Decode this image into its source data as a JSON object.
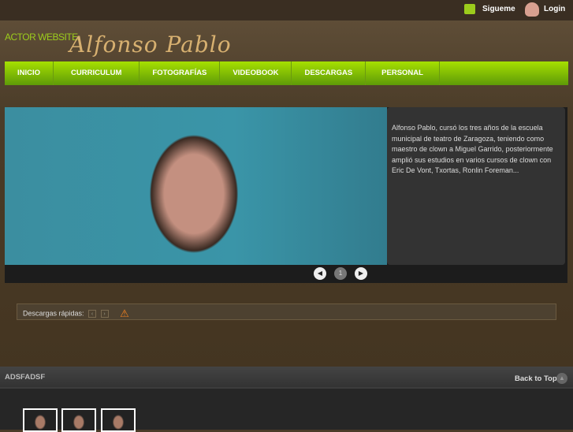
{
  "topbar": {
    "follow": "Sigueme",
    "login": "Login"
  },
  "header": {
    "tagline": "ACTOR WEBSITE",
    "name": "Alfonso Pablo"
  },
  "nav": [
    "INICIO",
    "CURRICULUM",
    "FOTOGRAFÍAS",
    "VIDEOBOOK",
    "DESCARGAS",
    "PERSONAL"
  ],
  "slider": {
    "description": "Alfonso Pablo, cursó los tres años de la escuela municipal de teatro de Zaragoza, teniendo como maestro de clown a Miguel Garrido, posteriormente amplió sus estudios en varios cursos de clown con Eric De Vont, Txortas, Ronlin Foreman...",
    "page": "1"
  },
  "quick": {
    "label": "Descargas rápidas:"
  },
  "footer": {
    "title": "ADSFADSF",
    "back_to_top": "Back to Top"
  }
}
